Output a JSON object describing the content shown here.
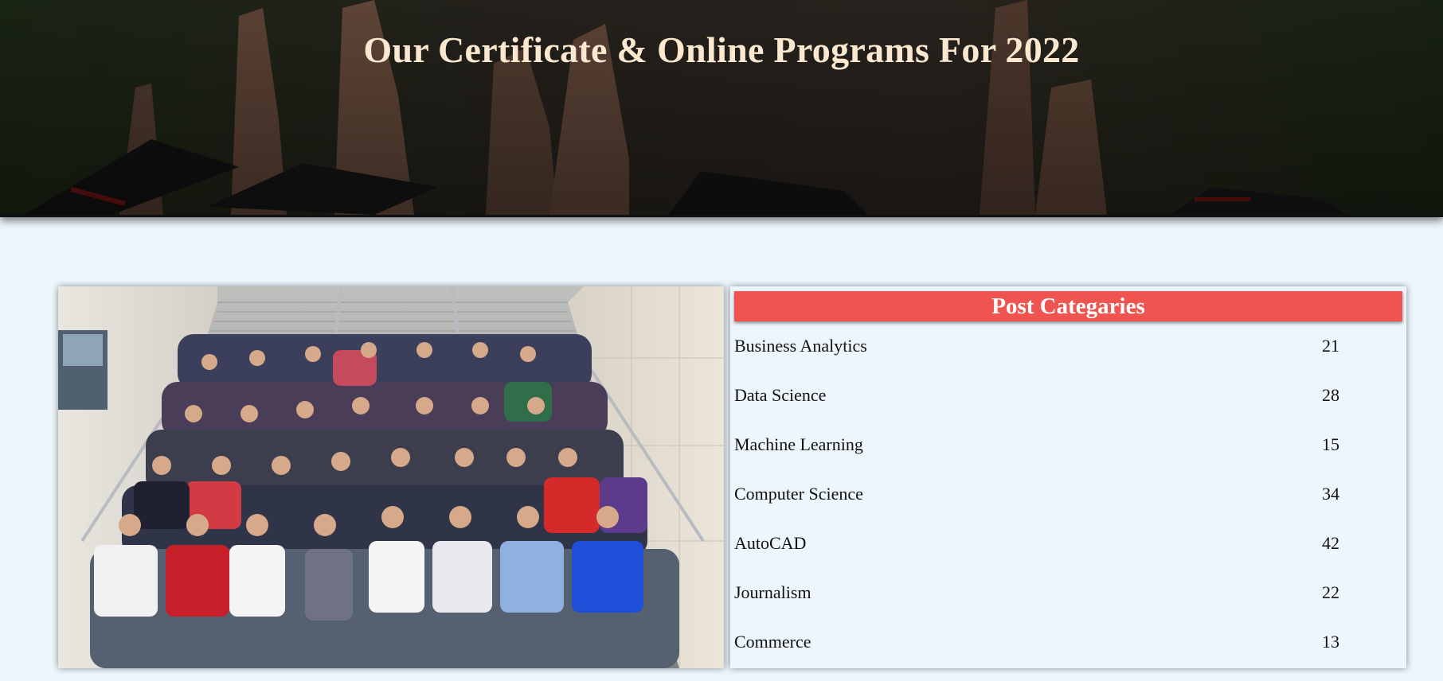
{
  "hero": {
    "title": "Our Certificate & Online Programs For 2022",
    "image": "graduation-caps-background"
  },
  "photo": {
    "image": "students-group-on-stairs-photo"
  },
  "categories": {
    "heading": "Post Categaries",
    "items": [
      {
        "name": "Business Analytics",
        "count": "21"
      },
      {
        "name": "Data Science",
        "count": "28"
      },
      {
        "name": "Machine Learning",
        "count": "15"
      },
      {
        "name": "Computer Science",
        "count": "34"
      },
      {
        "name": "AutoCAD",
        "count": "42"
      },
      {
        "name": "Journalism",
        "count": "22"
      },
      {
        "name": "Commerce",
        "count": "13"
      }
    ]
  },
  "colors": {
    "header_accent": "#ef5450",
    "hero_title": "#fbe8cf",
    "page_background": "#eef6fd"
  }
}
